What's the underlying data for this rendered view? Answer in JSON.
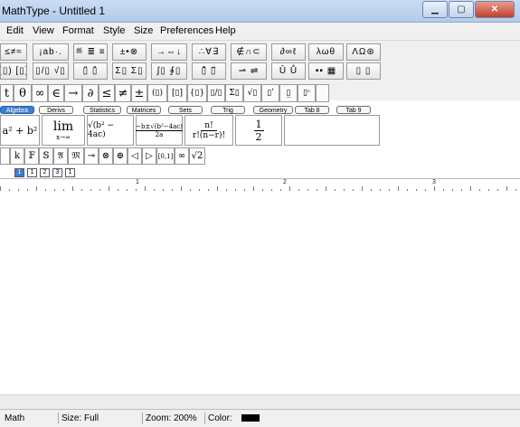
{
  "window": {
    "title": "MathType - Untitled 1"
  },
  "menu": [
    "Edit",
    "View",
    "Format",
    "Style",
    "Size",
    "Preferences",
    "Help"
  ],
  "palette_row1": [
    "≤≠≈",
    "¡ab·.",
    "≝ ≣ ≡",
    "±•⊗",
    "→⇔↓",
    "∴∀∃",
    "∉∩⊂",
    "∂∞ℓ",
    "λωθ",
    "ΛΩ⊛"
  ],
  "palette_row2": [
    "(▯) [▯]",
    "▯/▯ √▯",
    "▯̈ ▯̂",
    "Σ▯ Σ▯",
    "∫▯ ∮▯",
    "▯̄ ▯⃗",
    "⇀ ⇌",
    "Ū Ů",
    "▪▪ ▦",
    "▯ ▯"
  ],
  "big_symbols": [
    "t",
    "θ",
    "∞",
    "∈",
    "→",
    "∂",
    "≤",
    "≠",
    "±",
    "(▯)",
    "[▯]",
    "{▯}",
    "▯/▯",
    "Σ▯",
    "√▯",
    "▯ʹ",
    "▯̲",
    "▯ᶜ"
  ],
  "tabs": [
    "Algebra",
    "Derivs",
    "Statistics",
    "Matrices",
    "Sets",
    "Trig",
    "Geometry",
    "Tab 8",
    "Tab 9"
  ],
  "templates": {
    "t1": "a² + b²",
    "t2_top": "lim",
    "t2_bottom": "x→∞",
    "t3": "√(b² − 4ac)",
    "t4_top": "−b±√(b²−4ac)",
    "t4_bottom": "2a",
    "t5_top": "n!",
    "t5_bottom": "r!(n−r)!",
    "t6_top": "1",
    "t6_bottom": "2"
  },
  "small_symbols": [
    "k",
    "𝔽",
    "𝕊",
    "𝔄",
    "𝔐",
    "⊸",
    "⊗",
    "⊕",
    "◁",
    "▷",
    "[0,1]",
    "∞",
    "√2"
  ],
  "size_buttons": [
    "1",
    "1",
    "2",
    "3",
    "1"
  ],
  "ruler_numbers": [
    "1",
    "2",
    "3"
  ],
  "status": {
    "style": "Math",
    "size": "Size: Full",
    "zoom": "Zoom: 200%",
    "color": "Color:",
    "color_value": "#000000"
  }
}
